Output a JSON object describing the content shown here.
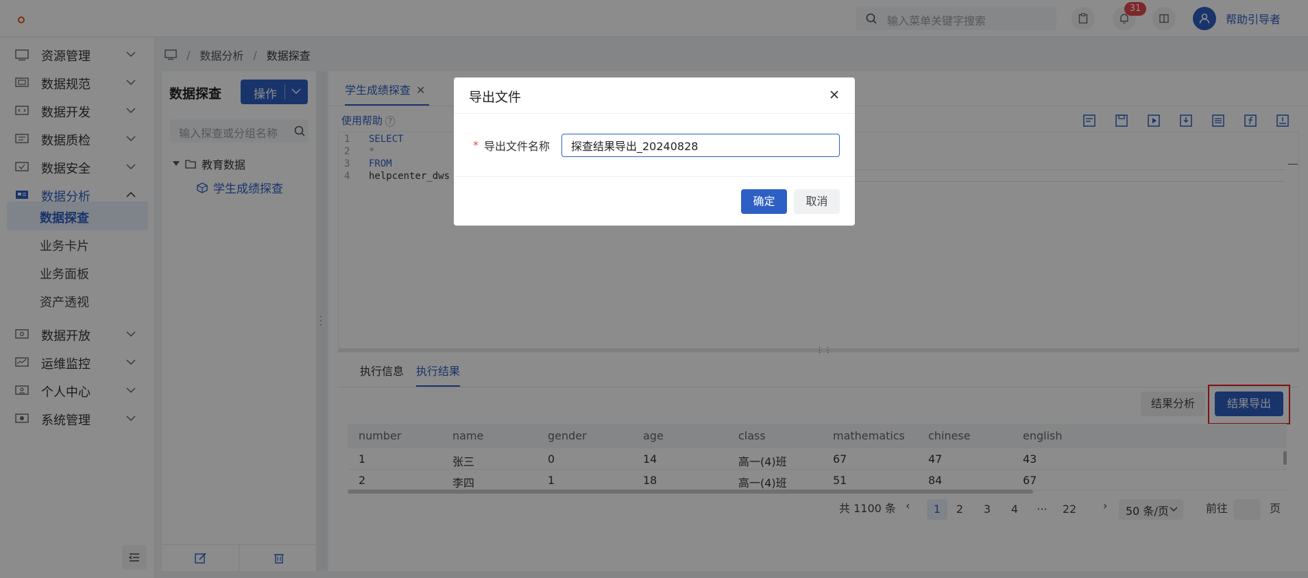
{
  "header": {
    "search_placeholder": "输入菜单关键字搜索",
    "notification_count": "31",
    "username": "帮助引导者"
  },
  "sidebar": {
    "items": [
      {
        "label": "资源管理",
        "icon": "server-icon"
      },
      {
        "label": "数据规范",
        "icon": "monitor-icon"
      },
      {
        "label": "数据开发",
        "icon": "code-icon"
      },
      {
        "label": "数据质检",
        "icon": "check-doc-icon"
      },
      {
        "label": "数据安全",
        "icon": "shield-icon"
      },
      {
        "label": "数据分析",
        "icon": "chart-icon"
      },
      {
        "label": "数据开放",
        "icon": "share-icon"
      },
      {
        "label": "运维监控",
        "icon": "monitor-line-icon"
      },
      {
        "label": "个人中心",
        "icon": "user-card-icon"
      },
      {
        "label": "系统管理",
        "icon": "settings-icon"
      }
    ],
    "sub_items": [
      "数据探查",
      "业务卡片",
      "业务面板",
      "资产透视"
    ]
  },
  "breadcrumb": [
    "数据分析",
    "数据探查"
  ],
  "tree_panel": {
    "title": "数据探查",
    "op_button": "操作",
    "search_placeholder": "输入探查或分组名称",
    "folder": "教育数据",
    "leaf": "学生成绩探查"
  },
  "main": {
    "tab": "学生成绩探查",
    "help": "使用帮助",
    "code": [
      {
        "n": "1",
        "text": "SELECT",
        "cls": "kw"
      },
      {
        "n": "2",
        "text": "*",
        "cls": "dim"
      },
      {
        "n": "3",
        "text": "FROM",
        "cls": "kw"
      },
      {
        "n": "4",
        "text": "helpcenter_dws",
        "cls": "plain"
      }
    ],
    "result_tabs": [
      "执行信息",
      "执行结果"
    ],
    "analyze_button": "结果分析",
    "export_button": "结果导出",
    "table": {
      "columns": [
        "number",
        "name",
        "gender",
        "age",
        "class",
        "mathematics",
        "chinese",
        "english"
      ],
      "rows": [
        [
          "1",
          "张三",
          "0",
          "14",
          "高一(4)班",
          "67",
          "47",
          "43"
        ],
        [
          "2",
          "李四",
          "1",
          "18",
          "高一(4)班",
          "51",
          "84",
          "67"
        ]
      ]
    },
    "pagination": {
      "total": "共 1100 条",
      "pages": [
        "1",
        "2",
        "3",
        "4",
        "···",
        "22"
      ],
      "page_size": "50 条/页",
      "goto_label": "前往",
      "page_unit": "页"
    }
  },
  "modal": {
    "title": "导出文件",
    "required_mark": "*",
    "field_label": "导出文件名称",
    "field_value": "探查结果导出_20240828",
    "ok": "确定",
    "cancel": "取消"
  }
}
